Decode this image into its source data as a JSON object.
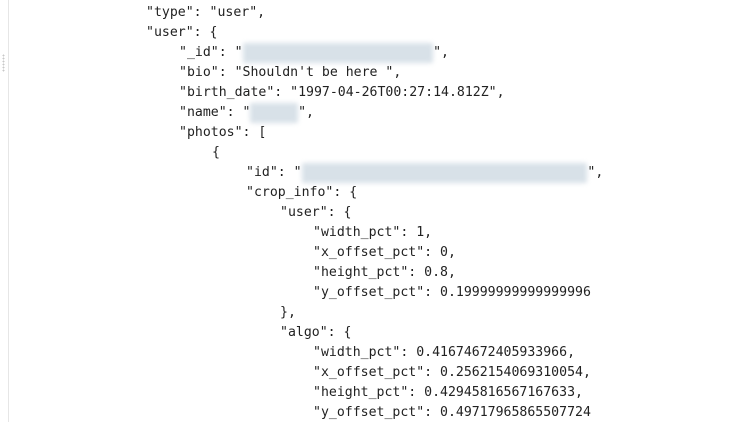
{
  "json_lines": [
    {
      "indent": 146,
      "parts": [
        {
          "t": "\"type\": \"user\","
        }
      ]
    },
    {
      "indent": 146,
      "parts": [
        {
          "t": "\"user\": {"
        }
      ]
    },
    {
      "indent": 179,
      "parts": [
        {
          "t": "\"_id\": \""
        },
        {
          "t": "5e0fa0811be0000c00af2bd7",
          "r": true
        },
        {
          "t": "\","
        }
      ]
    },
    {
      "indent": 179,
      "parts": [
        {
          "t": "\"bio\": \"Shouldn't be here \","
        }
      ]
    },
    {
      "indent": 179,
      "parts": [
        {
          "t": "\"birth_date\": \"1997-04-26T00:27:14.812Z\","
        }
      ]
    },
    {
      "indent": 179,
      "parts": [
        {
          "t": "\"name\": \""
        },
        {
          "t": "Linsey",
          "r": true
        },
        {
          "t": "\","
        }
      ]
    },
    {
      "indent": 179,
      "parts": [
        {
          "t": "\"photos\": ["
        }
      ]
    },
    {
      "indent": 212,
      "parts": [
        {
          "t": "{"
        }
      ]
    },
    {
      "indent": 246,
      "parts": [
        {
          "t": "\"id\": \""
        },
        {
          "t": "07f3e64d-cdca-4db3-81d4-313fcc9072f9",
          "r": true
        },
        {
          "t": "\","
        }
      ]
    },
    {
      "indent": 246,
      "parts": [
        {
          "t": "\"crop_info\": {"
        }
      ]
    },
    {
      "indent": 280,
      "parts": [
        {
          "t": "\"user\": {"
        }
      ]
    },
    {
      "indent": 313,
      "parts": [
        {
          "t": "\"width_pct\": 1,"
        }
      ]
    },
    {
      "indent": 313,
      "parts": [
        {
          "t": "\"x_offset_pct\": 0,"
        }
      ]
    },
    {
      "indent": 313,
      "parts": [
        {
          "t": "\"height_pct\": 0.8,"
        }
      ]
    },
    {
      "indent": 313,
      "parts": [
        {
          "t": "\"y_offset_pct\": 0.19999999999999996"
        }
      ]
    },
    {
      "indent": 280,
      "parts": [
        {
          "t": "},"
        }
      ]
    },
    {
      "indent": 280,
      "parts": [
        {
          "t": "\"algo\": {"
        }
      ]
    },
    {
      "indent": 313,
      "parts": [
        {
          "t": "\"width_pct\": 0.41674672405933966,"
        }
      ]
    },
    {
      "indent": 313,
      "parts": [
        {
          "t": "\"x_offset_pct\": 0.2562154069310054,"
        }
      ]
    },
    {
      "indent": 313,
      "parts": [
        {
          "t": "\"height_pct\": 0.42945816567167633,"
        }
      ]
    },
    {
      "indent": 313,
      "parts": [
        {
          "t": "\"y_offset_pct\": 0.49717965865507724"
        }
      ]
    }
  ]
}
